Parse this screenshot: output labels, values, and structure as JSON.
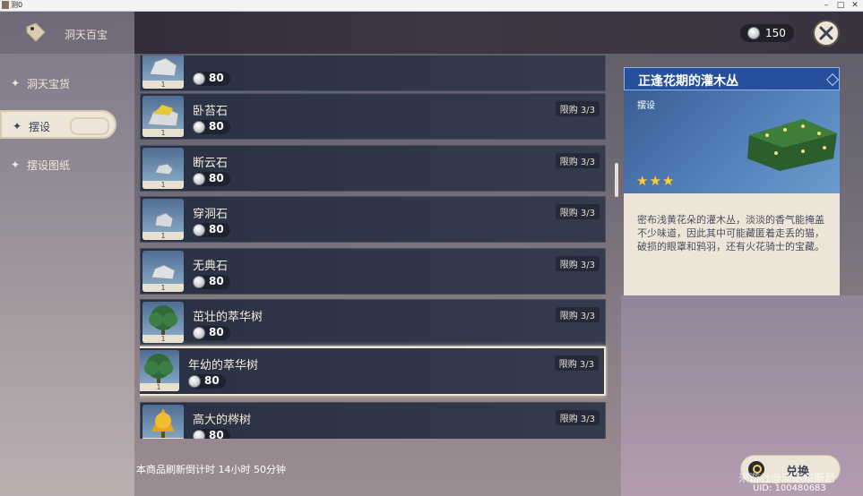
{
  "window": {
    "title": "测0"
  },
  "header": {
    "title": "洞天百宝",
    "currency": "150"
  },
  "nav": [
    {
      "label": "洞天宝货"
    },
    {
      "label": "摆设"
    },
    {
      "label": "摆设图纸"
    }
  ],
  "items": [
    {
      "name": "",
      "price": "80",
      "count": "1",
      "limit": "",
      "thumb": "rock"
    },
    {
      "name": "卧苔石",
      "price": "80",
      "count": "1",
      "limit": "限购 3/3",
      "thumb": "mossrock"
    },
    {
      "name": "断云石",
      "price": "80",
      "count": "1",
      "limit": "限购 3/3",
      "thumb": "rock"
    },
    {
      "name": "穿洞石",
      "price": "80",
      "count": "1",
      "limit": "限购 3/3",
      "thumb": "rock"
    },
    {
      "name": "无典石",
      "price": "80",
      "count": "1",
      "limit": "限购 3/3",
      "thumb": "rock"
    },
    {
      "name": "茁壮的萃华树",
      "price": "80",
      "count": "1",
      "limit": "限购 3/3",
      "thumb": "tree"
    },
    {
      "name": "年幼的萃华树",
      "price": "80",
      "count": "1",
      "limit": "限购 3/3",
      "thumb": "tree"
    },
    {
      "name": "高大的梣树",
      "price": "80",
      "count": "1",
      "limit": "限购 3/3",
      "thumb": "yellowtree"
    }
  ],
  "detail": {
    "title": "正逢花期的灌木丛",
    "type": "摆设",
    "stars": "★★★",
    "description": "密布浅黄花朵的灌木丛，淡淡的香气能掩盖不少味道，因此其中可能藏匿着走丢的猫，破损的眼罩和鸦羽，还有火花骑士的宝藏。"
  },
  "footer": {
    "refresh": "本商品刷新倒计时 14小时 50分钟",
    "exchange": "兑换",
    "watermark": "米游社@淡达布斯尼",
    "uid": "UID: 100480683"
  }
}
